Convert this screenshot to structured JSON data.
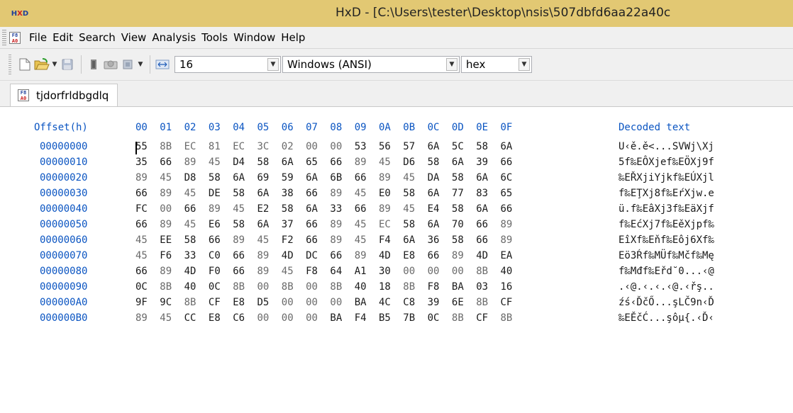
{
  "window": {
    "title": "HxD - [C:\\Users\\tester\\Desktop\\nsis\\507dbfd6aa22a40c"
  },
  "menu": [
    "File",
    "Edit",
    "Search",
    "View",
    "Analysis",
    "Tools",
    "Window",
    "Help"
  ],
  "toolbar": {
    "bytes_per_row": "16",
    "charset": "Windows (ANSI)",
    "offset_base": "hex"
  },
  "tab": {
    "label": "tjdorfrldbgdlq"
  },
  "header": {
    "offset_label": "Offset(h)",
    "columns": [
      "00",
      "01",
      "02",
      "03",
      "04",
      "05",
      "06",
      "07",
      "08",
      "09",
      "0A",
      "0B",
      "0C",
      "0D",
      "0E",
      "0F"
    ],
    "text_label": "Decoded text"
  },
  "rows": [
    {
      "offset": "00000000",
      "bytes": [
        "55",
        "8B",
        "EC",
        "81",
        "EC",
        "3C",
        "02",
        "00",
        "00",
        "53",
        "56",
        "57",
        "6A",
        "5C",
        "58",
        "6A"
      ],
      "text": "U‹ě.ě<...SVWj\\Xj"
    },
    {
      "offset": "00000010",
      "bytes": [
        "35",
        "66",
        "89",
        "45",
        "D4",
        "58",
        "6A",
        "65",
        "66",
        "89",
        "45",
        "D6",
        "58",
        "6A",
        "39",
        "66"
      ],
      "text": "5f‰EÔXjef‰EÖXj9f"
    },
    {
      "offset": "00000020",
      "bytes": [
        "89",
        "45",
        "D8",
        "58",
        "6A",
        "69",
        "59",
        "6A",
        "6B",
        "66",
        "89",
        "45",
        "DA",
        "58",
        "6A",
        "6C"
      ],
      "text": "‰EŘXjiYjkf‰EÚXjl"
    },
    {
      "offset": "00000030",
      "bytes": [
        "66",
        "89",
        "45",
        "DE",
        "58",
        "6A",
        "38",
        "66",
        "89",
        "45",
        "E0",
        "58",
        "6A",
        "77",
        "83",
        "65"
      ],
      "text": "f‰EŢXj8f‰EŕXjw.e"
    },
    {
      "offset": "00000040",
      "bytes": [
        "FC",
        "00",
        "66",
        "89",
        "45",
        "E2",
        "58",
        "6A",
        "33",
        "66",
        "89",
        "45",
        "E4",
        "58",
        "6A",
        "66"
      ],
      "text": "ü.f‰EâXj3f‰EäXjf"
    },
    {
      "offset": "00000050",
      "bytes": [
        "66",
        "89",
        "45",
        "E6",
        "58",
        "6A",
        "37",
        "66",
        "89",
        "45",
        "EC",
        "58",
        "6A",
        "70",
        "66",
        "89"
      ],
      "text": "f‰EćXj7f‰EěXjpf‰"
    },
    {
      "offset": "00000060",
      "bytes": [
        "45",
        "EE",
        "58",
        "66",
        "89",
        "45",
        "F2",
        "66",
        "89",
        "45",
        "F4",
        "6A",
        "36",
        "58",
        "66",
        "89"
      ],
      "text": "EîXf‰Eňf‰Eôj6Xf‰"
    },
    {
      "offset": "00000070",
      "bytes": [
        "45",
        "F6",
        "33",
        "C0",
        "66",
        "89",
        "4D",
        "DC",
        "66",
        "89",
        "4D",
        "E8",
        "66",
        "89",
        "4D",
        "EA"
      ],
      "text": "Eö3Ŕf‰MÜf‰Mčf‰Mę"
    },
    {
      "offset": "00000080",
      "bytes": [
        "66",
        "89",
        "4D",
        "F0",
        "66",
        "89",
        "45",
        "F8",
        "64",
        "A1",
        "30",
        "00",
        "00",
        "00",
        "8B",
        "40"
      ],
      "text": "f‰Mđf‰Eřd˘0...‹@"
    },
    {
      "offset": "00000090",
      "bytes": [
        "0C",
        "8B",
        "40",
        "0C",
        "8B",
        "00",
        "8B",
        "00",
        "8B",
        "40",
        "18",
        "8B",
        "F8",
        "BA",
        "03",
        "16"
      ],
      "text": ".‹@.‹.‹.‹@.‹řş.."
    },
    {
      "offset": "000000A0",
      "bytes": [
        "9F",
        "9C",
        "8B",
        "CF",
        "E8",
        "D5",
        "00",
        "00",
        "00",
        "BA",
        "4C",
        "C8",
        "39",
        "6E",
        "8B",
        "CF"
      ],
      "text": "źś‹ĎčŐ...şLČ9n‹Ď"
    },
    {
      "offset": "000000B0",
      "bytes": [
        "89",
        "45",
        "CC",
        "E8",
        "C6",
        "00",
        "00",
        "00",
        "BA",
        "F4",
        "B5",
        "7B",
        "0C",
        "8B",
        "CF",
        "8B"
      ],
      "text": "‰EĚčĆ...şôµ{.‹Ď‹"
    }
  ]
}
